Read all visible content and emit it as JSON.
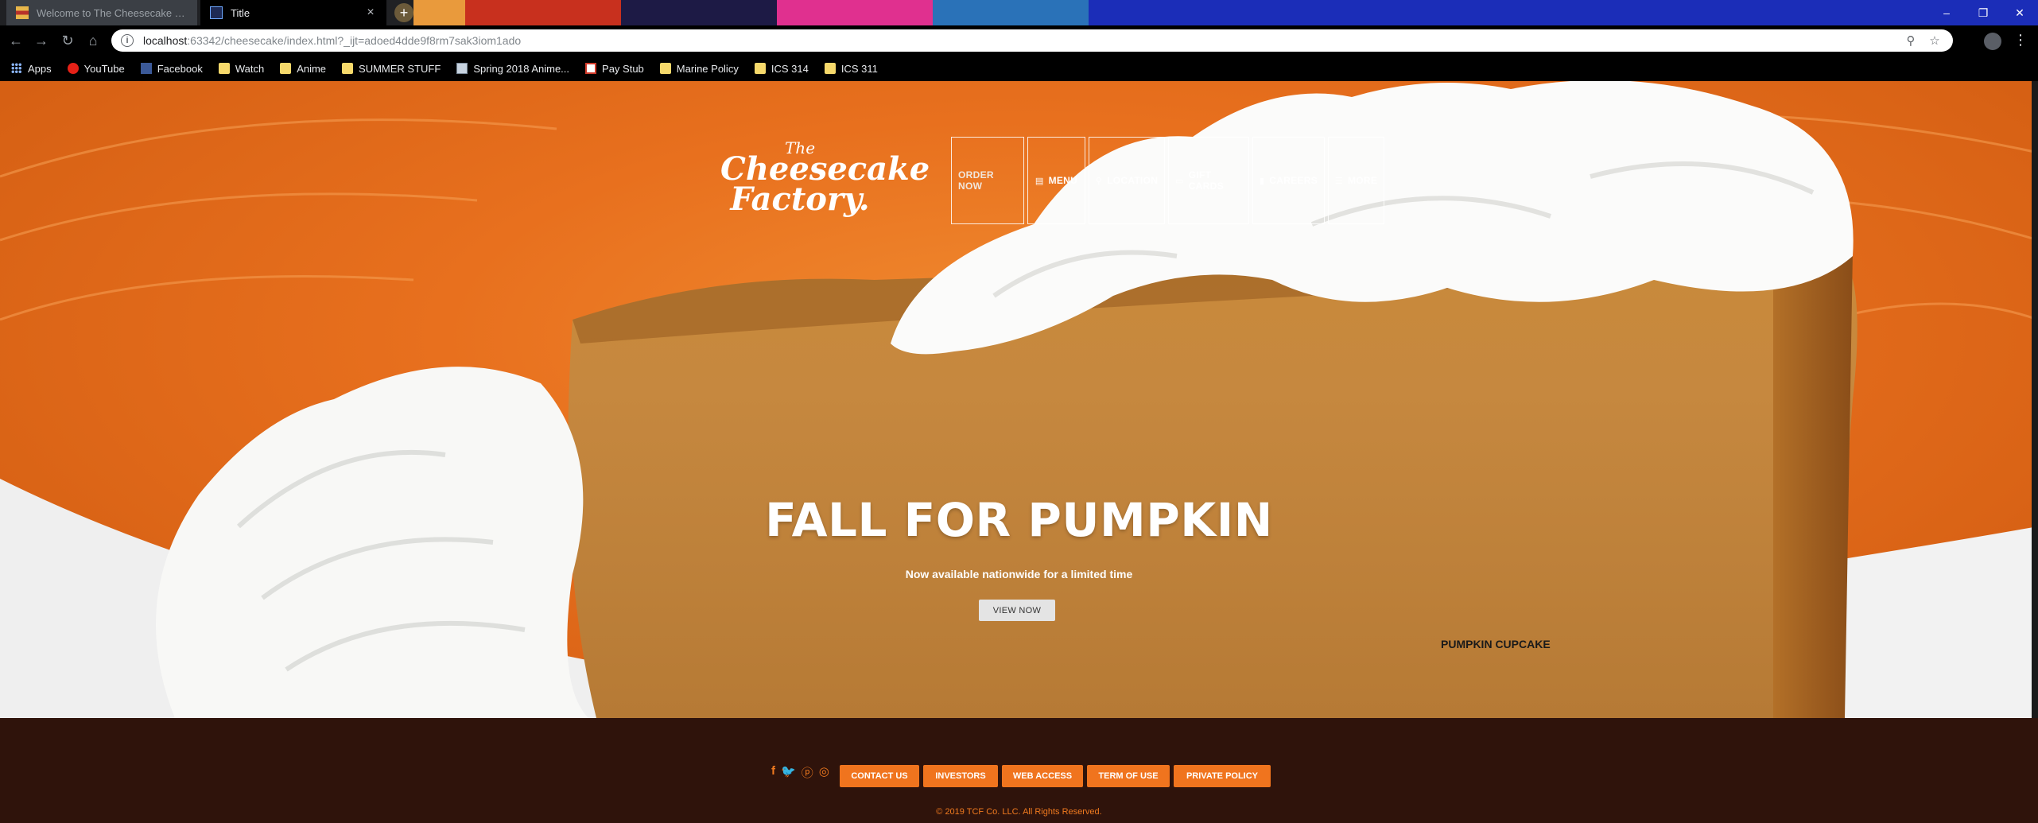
{
  "browser": {
    "tabs": [
      {
        "title": "Welcome to The Cheesecake Fac",
        "active": false,
        "favicon": "cheesecake-favicon"
      },
      {
        "title": "Title",
        "active": true,
        "favicon": "webstorm-icon"
      }
    ],
    "new_tab_label": "+",
    "window_controls": {
      "minimize": "–",
      "restore": "❐",
      "close": "✕"
    },
    "address": {
      "host": "localhost",
      "rest": ":63342/cheesecake/index.html?_ijt=adoed4dde9f8rm7sak3iom1ado"
    },
    "nav": {
      "back": "←",
      "forward": "→",
      "reload": "↻",
      "home": "⌂"
    },
    "omnibox_icons": {
      "zoom": "⚲",
      "star": "☆"
    },
    "menu": "⋮",
    "bookmarks": [
      {
        "label": "Apps",
        "icon": "apps-grid"
      },
      {
        "label": "YouTube",
        "icon": "youtube-icon"
      },
      {
        "label": "Facebook",
        "icon": "facebook-icon"
      },
      {
        "label": "Watch",
        "icon": "folder-icon"
      },
      {
        "label": "Anime",
        "icon": "folder-icon"
      },
      {
        "label": "SUMMER STUFF",
        "icon": "folder-icon"
      },
      {
        "label": "Spring 2018 Anime...",
        "icon": "site-icon"
      },
      {
        "label": "Pay Stub",
        "icon": "site-icon"
      },
      {
        "label": "Marine Policy",
        "icon": "folder-icon"
      },
      {
        "label": "ICS 314",
        "icon": "folder-icon"
      },
      {
        "label": "ICS 311",
        "icon": "folder-icon"
      }
    ]
  },
  "site": {
    "logo": {
      "line1": "The",
      "line2": "Cheesecake",
      "line3": "Factory."
    },
    "nav": [
      {
        "label": "ORDER NOW",
        "icon": ""
      },
      {
        "label": "MENU",
        "icon": "▤"
      },
      {
        "label": "LOCATION",
        "icon": "⚲"
      },
      {
        "label": "GIFT CARDS",
        "icon": "▭"
      },
      {
        "label": "CAREERS",
        "icon": "▮"
      },
      {
        "label": "MORE",
        "icon": "☰"
      }
    ],
    "hero": {
      "headline": "FALL FOR PUMPKIN",
      "subline": "Now available nationwide for a limited time",
      "button": "VIEW NOW",
      "caption": "PUMPKIN CUPCAKE"
    },
    "footer": {
      "social": [
        "f",
        "🐦",
        "ⓟ",
        "◎"
      ],
      "links": [
        "CONTACT US",
        "INVESTORS",
        "WEB ACCESS",
        "TERM OF USE",
        "PRIVATE POLICY"
      ],
      "copyright": "© 2019 TCF Co. LLC. All Rights Reserved."
    }
  },
  "colors": {
    "accent": "#f0741e",
    "footer_bg": "#2f130b"
  }
}
